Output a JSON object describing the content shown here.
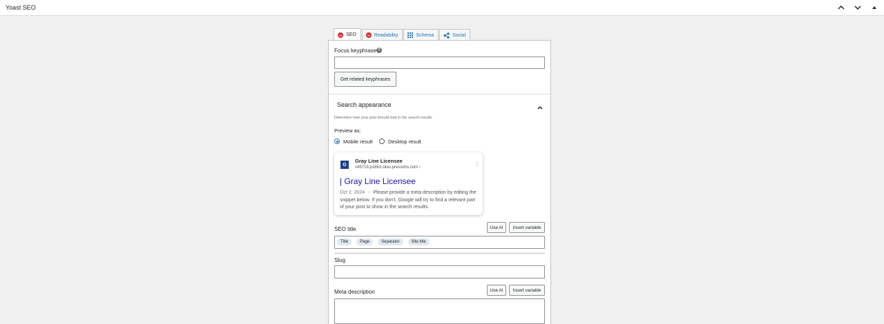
{
  "metabox": {
    "title": "Yoast SEO"
  },
  "tabs": [
    {
      "label": "SEO"
    },
    {
      "label": "Readability"
    },
    {
      "label": "Schema"
    },
    {
      "label": "Social"
    }
  ],
  "focus": {
    "label": "Focus keyphrase",
    "help": "?",
    "value": "",
    "related_button": "Get related keyphrases"
  },
  "search_appearance": {
    "heading": "Search appearance",
    "description": "Determine how your post should look in the search results.",
    "preview_label": "Preview as:",
    "options": [
      "Mobile result",
      "Desktop result"
    ],
    "selected": "Mobile result"
  },
  "serp": {
    "favicon": "G",
    "site_name": "Gray Line Licensee",
    "url": "s45719.p1663.sites.pressdns.com ›",
    "more": "⋮",
    "title": "| Gray Line Licensee",
    "date": "Oct 2, 2024",
    "separator": "-",
    "description": "Please provide a meta description by editing the snippet below. If you don’t, Google will try to find a relevant part of your post to show in the search results."
  },
  "seo_title": {
    "label": "SEO title",
    "use_ai": "Use AI",
    "insert_variable": "Insert variable",
    "chips": [
      "Title",
      "Page",
      "Separator",
      "Site title"
    ]
  },
  "slug": {
    "label": "Slug",
    "value": ""
  },
  "meta_description": {
    "label": "Meta description",
    "use_ai": "Use AI",
    "insert_variable": "Insert variable",
    "value": ""
  },
  "colors": {
    "accent": "#2271b1",
    "problem": "#dc3232",
    "serp_title": "#1a0dab"
  }
}
